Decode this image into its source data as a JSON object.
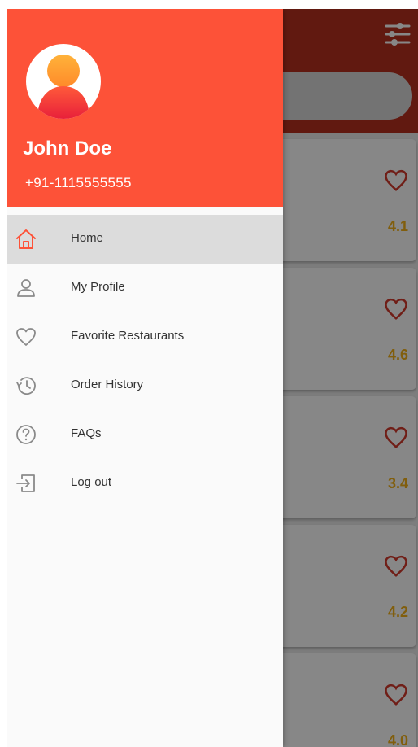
{
  "user": {
    "name": "John Doe",
    "phone": "+91-1115555555"
  },
  "menu": {
    "items": [
      {
        "label": "Home",
        "icon": "home-icon",
        "active": true
      },
      {
        "label": "My Profile",
        "icon": "profile-icon",
        "active": false
      },
      {
        "label": "Favorite Restaurants",
        "icon": "heart-icon",
        "active": false
      },
      {
        "label": "Order History",
        "icon": "history-icon",
        "active": false
      },
      {
        "label": "FAQs",
        "icon": "question-icon",
        "active": false
      },
      {
        "label": "Log out",
        "icon": "logout-icon",
        "active": false
      }
    ]
  },
  "restaurants": {
    "ratings": [
      "4.1",
      "4.6",
      "3.4",
      "4.2",
      "4.0"
    ]
  },
  "colors": {
    "accent": "#fd5238",
    "rating": "#f3b21a",
    "drawer_bg": "#fafafa",
    "active_bg": "#dcdcdc"
  }
}
